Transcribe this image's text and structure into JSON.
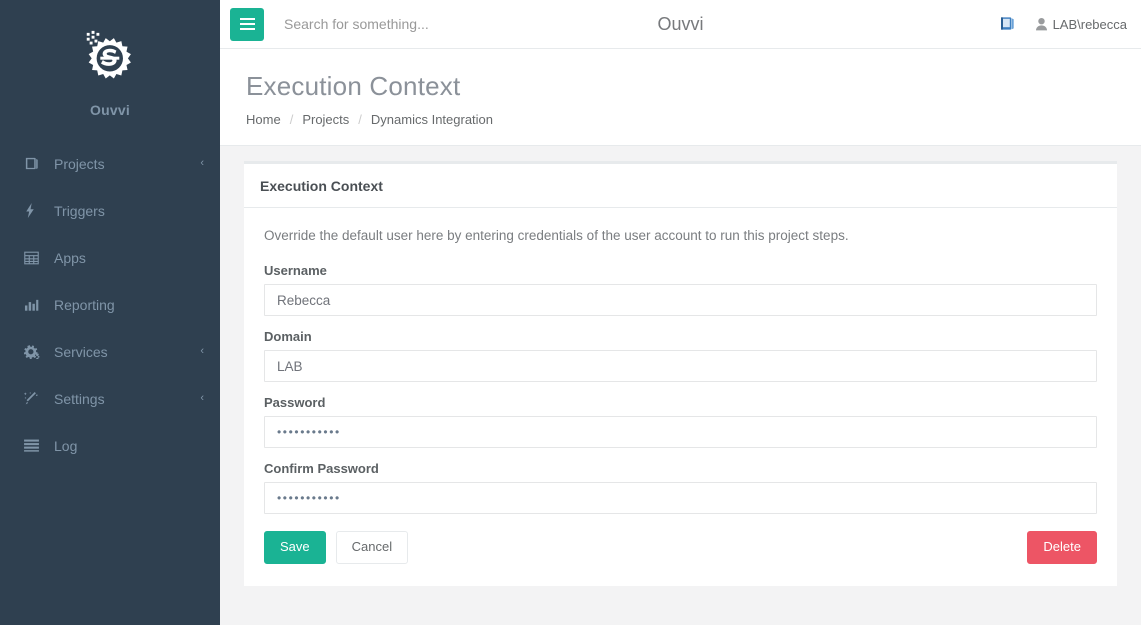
{
  "colors": {
    "sidebar_bg": "#2f4050",
    "accent_green": "#1ab394",
    "danger_red": "#ed5565",
    "page_bg": "#f3f3f4",
    "muted_text": "#8095a8"
  },
  "sidebar": {
    "brand_name": "Ouvvi",
    "logo_icon": "gear-s-logo-icon",
    "items": [
      {
        "label": "Projects",
        "icon": "book-icon",
        "has_chevron": true,
        "chevron": "‹"
      },
      {
        "label": "Triggers",
        "icon": "bolt-icon",
        "has_chevron": false,
        "chevron": ""
      },
      {
        "label": "Apps",
        "icon": "table-icon",
        "has_chevron": false,
        "chevron": ""
      },
      {
        "label": "Reporting",
        "icon": "bar-chart-icon",
        "has_chevron": false,
        "chevron": ""
      },
      {
        "label": "Services",
        "icon": "gears-icon",
        "has_chevron": true,
        "chevron": "‹"
      },
      {
        "label": "Settings",
        "icon": "magic-wand-icon",
        "has_chevron": true,
        "chevron": "‹"
      },
      {
        "label": "Log",
        "icon": "list-icon",
        "has_chevron": false,
        "chevron": ""
      }
    ]
  },
  "topbar": {
    "menu_toggle_icon": "hamburger-icon",
    "search_placeholder": "Search for something...",
    "search_value": "",
    "app_title": "Ouvvi",
    "manual_icon": "blue-book-icon",
    "user_icon": "user-icon",
    "user_name": "LAB\\rebecca"
  },
  "pagehead": {
    "title": "Execution Context",
    "breadcrumb": [
      {
        "label": "Home"
      },
      {
        "label": "Projects"
      },
      {
        "label": "Dynamics Integration"
      }
    ],
    "separator": "/"
  },
  "card": {
    "title": "Execution Context",
    "description": "Override the default user here by entering credentials of the user account to run this project steps.",
    "fields": [
      {
        "label": "Username",
        "value": "Rebecca",
        "type": "text",
        "name": "username-field"
      },
      {
        "label": "Domain",
        "value": "LAB",
        "type": "text",
        "name": "domain-field"
      },
      {
        "label": "Password",
        "value": "•••••••••••",
        "type": "password",
        "name": "password-field"
      },
      {
        "label": "Confirm Password",
        "value": "•••••••••••",
        "type": "password",
        "name": "confirm-password-field"
      }
    ],
    "buttons": {
      "save": "Save",
      "cancel": "Cancel",
      "delete": "Delete"
    }
  }
}
